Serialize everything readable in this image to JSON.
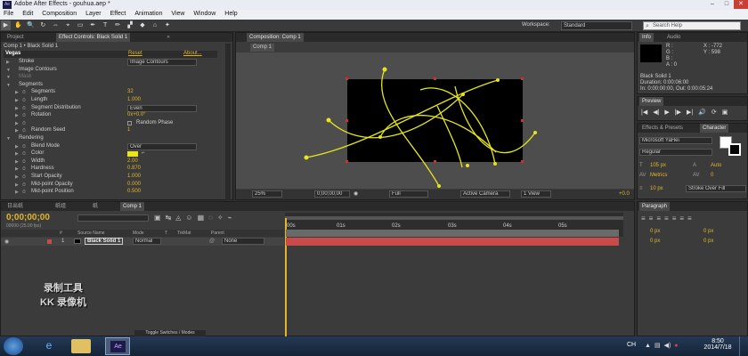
{
  "app": {
    "badge": "Ae",
    "window_title": "Adobe After Effects - gouhua.aep *"
  },
  "window_controls": {
    "minimize": "–",
    "maximize": "□",
    "close": "✕"
  },
  "menu": [
    "File",
    "Edit",
    "Composition",
    "Layer",
    "Effect",
    "Animation",
    "View",
    "Window",
    "Help"
  ],
  "toolbar": {
    "tools": [
      "▶",
      "✋",
      "🔍",
      "↻",
      "⇔",
      "⌖",
      "▭",
      "✒",
      "T",
      "✏",
      "▞",
      "◆",
      "⌂",
      "✦"
    ],
    "workspace_label": "Workspace:",
    "workspace_value": "Standard",
    "search_placeholder": "Search Help"
  },
  "project_panel": {
    "tabs": [
      "Project",
      "Effect Controls: Black Solid 1"
    ],
    "header": "Comp 1 • Black Solid 1",
    "effect_name": "Vegas",
    "reset": "Reset",
    "about": "About...",
    "rows": [
      {
        "label": "Stroke",
        "value": "Image Contours",
        "kind": "dd",
        "indent": 1
      },
      {
        "label": "Image Contours",
        "value": "",
        "kind": "group",
        "indent": 1
      },
      {
        "label": "Mask",
        "value": "",
        "kind": "group-dim",
        "indent": 1
      },
      {
        "label": "Segments",
        "value": "",
        "kind": "group",
        "indent": 1
      },
      {
        "label": "Segments",
        "value": "32",
        "kind": "num",
        "indent": 2
      },
      {
        "label": "Length",
        "value": "1.000",
        "kind": "num",
        "indent": 2
      },
      {
        "label": "Segment Distribution",
        "value": "Even",
        "kind": "dd",
        "indent": 2
      },
      {
        "label": "Rotation",
        "value": "0x+0.0°",
        "kind": "num",
        "indent": 2
      },
      {
        "label": "",
        "value": "Random Phase",
        "kind": "check",
        "indent": 2
      },
      {
        "label": "Random Seed",
        "value": "1",
        "kind": "num",
        "indent": 2
      },
      {
        "label": "Rendering",
        "value": "",
        "kind": "group",
        "indent": 1
      },
      {
        "label": "Blend Mode",
        "value": "Over",
        "kind": "dd",
        "indent": 2
      },
      {
        "label": "Color",
        "value": "",
        "kind": "color",
        "indent": 2
      },
      {
        "label": "Width",
        "value": "2.00",
        "kind": "num",
        "indent": 2
      },
      {
        "label": "Hardness",
        "value": "0.870",
        "kind": "num",
        "indent": 2
      },
      {
        "label": "Start Opacity",
        "value": "1.000",
        "kind": "num",
        "indent": 2
      },
      {
        "label": "Mid-point Opacity",
        "value": "0.000",
        "kind": "num",
        "indent": 2
      },
      {
        "label": "Mid-point Position",
        "value": "0.500",
        "kind": "num",
        "indent": 2
      }
    ]
  },
  "composition_panel": {
    "tab": "Composition: Comp 1",
    "subtab": "Comp 1",
    "zoom": "25%",
    "timecode": "0;00;00;00",
    "resolution": "Full",
    "camera": "Active Camera",
    "views": "1 View",
    "exposure": "+0.0"
  },
  "info_panel": {
    "tabs": [
      "Info",
      "Audio"
    ],
    "r": "R :",
    "g": "G :",
    "b": "B :",
    "a": "A : 0",
    "x": "X : -772",
    "y": "Y : 598",
    "layer": "Black Solid 1",
    "duration": "Duration: 0:00:06:00",
    "inout": "In: 0:00:00:00, Out: 0:00:05:24"
  },
  "preview_panel": {
    "tab": "Preview",
    "controls": [
      "|◀",
      "◀|",
      "▶",
      "|▶",
      "▶|",
      "🔊",
      "⟳",
      "▣"
    ]
  },
  "character_panel": {
    "tabs": [
      "Effects & Presets",
      "Character"
    ],
    "font": "Microsoft YaHei",
    "style": "Regular",
    "size": "105 px",
    "leading": "Auto",
    "kerning": "Metrics",
    "tracking": "0",
    "stroke_width": "10 px",
    "stroke_mode": "Stroke Over Fill",
    "color_fill": "#ffffff",
    "color_stroke": "#000000"
  },
  "paragraph_panel": {
    "tab": "Paragraph",
    "indent_left": "0 px",
    "indent_right": "0 px",
    "space_before": "0 px",
    "space_after": "0 px"
  },
  "timeline": {
    "tabs": [
      "日出纸",
      "纸组",
      "纸",
      "Comp 1"
    ],
    "timecode": "0;00;00;00",
    "fps": "00000 (25.00 fps)",
    "columns": [
      "#",
      "Source Name",
      "Mode",
      "T",
      "TrkMat",
      "Parent"
    ],
    "ruler": [
      "00s",
      "01s",
      "02s",
      "03s",
      "04s",
      "05s"
    ],
    "layers": [
      {
        "num": "1",
        "name": "Black Solid 1",
        "mode": "Normal",
        "parent": "None"
      }
    ],
    "toggle": "Toggle Switches / Modes"
  },
  "watermark": {
    "line1": "录制工具",
    "line2": "KK 录像机"
  },
  "taskbar": {
    "time": "8:50",
    "date": "2014/7/18",
    "app_ae": "Ae",
    "tray_text": "CH"
  },
  "colors": {
    "stroke_yellow": "#e6e619",
    "timeline_bar": "#c94a4a",
    "accent_orange": "#e0b52c"
  }
}
